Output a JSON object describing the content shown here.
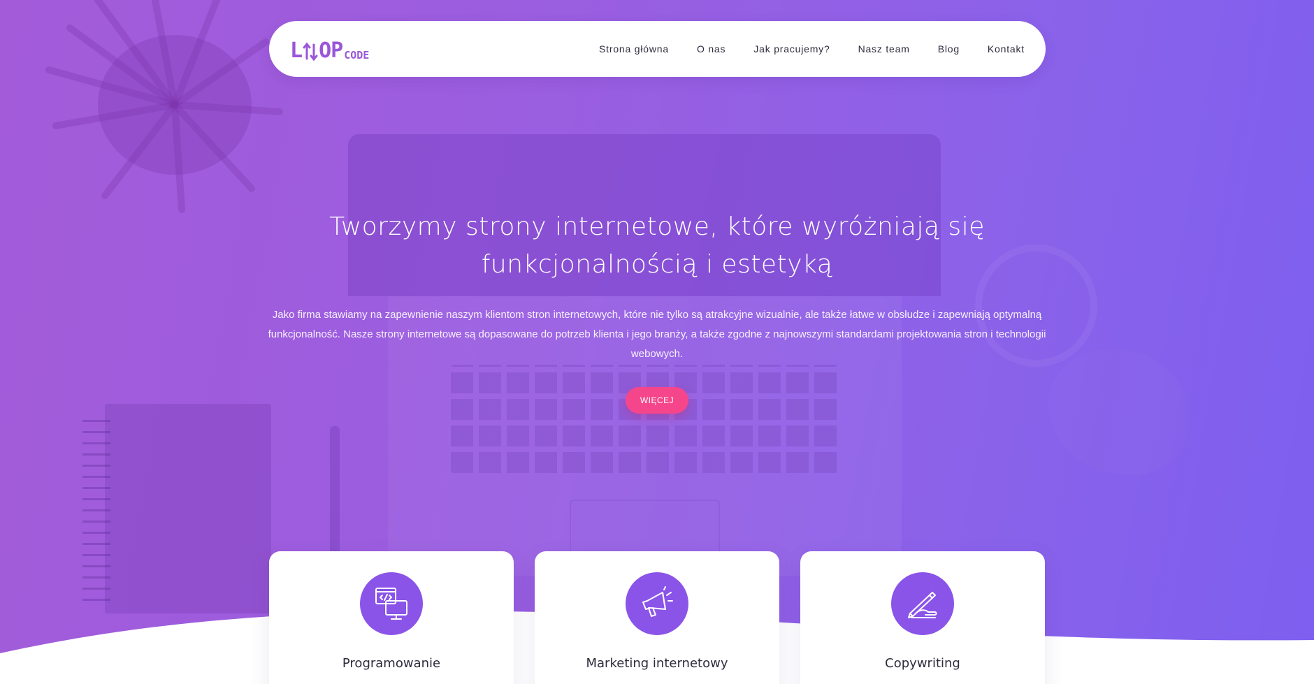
{
  "brand": {
    "logo_main": "L",
    "logo_after_icon": "OP",
    "logo_suffix": "CODE",
    "color": "#9a57d8"
  },
  "nav": {
    "items": [
      {
        "label": "Strona główna"
      },
      {
        "label": "O nas"
      },
      {
        "label": "Jak pracujemy?"
      },
      {
        "label": "Nasz team"
      },
      {
        "label": "Blog"
      },
      {
        "label": "Kontakt"
      }
    ]
  },
  "hero": {
    "title_line1": "Tworzymy strony internetowe, które wyróżniają się",
    "title_line2": "funkcjonalnością i estetyką",
    "description": "Jako firma stawiamy na zapewnienie naszym klientom stron internetowych, które nie tylko są atrakcyjne wizualnie, ale także łatwe w obsłudze i zapewniają optymalną funkcjonalność. Nasze strony internetowe są dopasowane do potrzeb klienta i jego branży, a także zgodne z najnowszymi standardami projektowania stron i technologii webowych.",
    "button_label": "WIĘCEJ",
    "gradient_start": "#a35bd9",
    "gradient_end": "#7d5fef",
    "button_color": "#f5468b"
  },
  "services": [
    {
      "title": "Programowanie",
      "icon": "code-monitor-icon"
    },
    {
      "title": "Marketing internetowy",
      "icon": "megaphone-icon"
    },
    {
      "title": "Copywriting",
      "icon": "writing-hand-icon"
    }
  ],
  "accent_color": "#8a54e8"
}
